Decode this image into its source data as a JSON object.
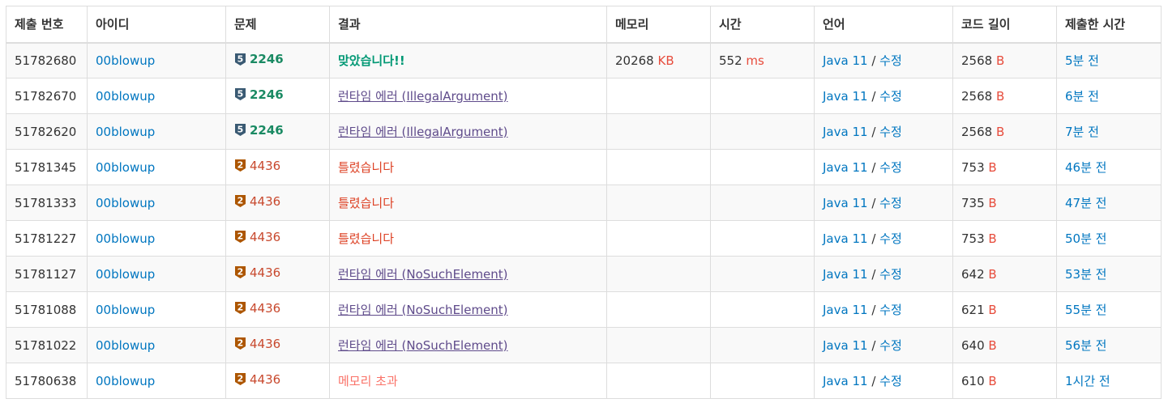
{
  "headers": {
    "submission_id": "제출 번호",
    "user_id": "아이디",
    "problem": "문제",
    "result": "결과",
    "memory": "메모리",
    "time": "시간",
    "language": "언어",
    "code_length": "코드 길이",
    "submitted_at": "제출한 시간"
  },
  "colors": {
    "link": "#0076c0",
    "accepted": "#009874",
    "wrong": "#dd4124",
    "runtime_error": "#5f4b8b",
    "memory_exceeded": "#fa7268",
    "unit": "#e74c3c",
    "platinum_badge": "#27a0a4",
    "bronze_badge": "#ad5600"
  },
  "rows": [
    {
      "id": "51782680",
      "user": "00blowup",
      "tier_icon": "platinum-5-icon",
      "tier_num": "5",
      "problem": "2246",
      "result": "맞았습니다!!",
      "result_type": "ac",
      "memory": "20268",
      "memory_unit": "KB",
      "time": "552",
      "time_unit": "ms",
      "language": "Java 11",
      "slash": "/",
      "edit": "수정",
      "length": "2568",
      "length_unit": "B",
      "submitted": "5분 전"
    },
    {
      "id": "51782670",
      "user": "00blowup",
      "tier_icon": "platinum-5-icon",
      "tier_num": "5",
      "problem": "2246",
      "result": "런타임 에러 (IllegalArgument)",
      "result_type": "rte",
      "memory": "",
      "memory_unit": "",
      "time": "",
      "time_unit": "",
      "language": "Java 11",
      "slash": "/",
      "edit": "수정",
      "length": "2568",
      "length_unit": "B",
      "submitted": "6분 전"
    },
    {
      "id": "51782620",
      "user": "00blowup",
      "tier_icon": "platinum-5-icon",
      "tier_num": "5",
      "problem": "2246",
      "result": "런타임 에러 (IllegalArgument)",
      "result_type": "rte",
      "memory": "",
      "memory_unit": "",
      "time": "",
      "time_unit": "",
      "language": "Java 11",
      "slash": "/",
      "edit": "수정",
      "length": "2568",
      "length_unit": "B",
      "submitted": "7분 전"
    },
    {
      "id": "51781345",
      "user": "00blowup",
      "tier_icon": "bronze-2-icon",
      "tier_num": "2",
      "problem": "4436",
      "result": "틀렸습니다",
      "result_type": "wa",
      "memory": "",
      "memory_unit": "",
      "time": "",
      "time_unit": "",
      "language": "Java 11",
      "slash": "/",
      "edit": "수정",
      "length": "753",
      "length_unit": "B",
      "submitted": "46분 전"
    },
    {
      "id": "51781333",
      "user": "00blowup",
      "tier_icon": "bronze-2-icon",
      "tier_num": "2",
      "problem": "4436",
      "result": "틀렸습니다",
      "result_type": "wa",
      "memory": "",
      "memory_unit": "",
      "time": "",
      "time_unit": "",
      "language": "Java 11",
      "slash": "/",
      "edit": "수정",
      "length": "735",
      "length_unit": "B",
      "submitted": "47분 전"
    },
    {
      "id": "51781227",
      "user": "00blowup",
      "tier_icon": "bronze-2-icon",
      "tier_num": "2",
      "problem": "4436",
      "result": "틀렸습니다",
      "result_type": "wa",
      "memory": "",
      "memory_unit": "",
      "time": "",
      "time_unit": "",
      "language": "Java 11",
      "slash": "/",
      "edit": "수정",
      "length": "753",
      "length_unit": "B",
      "submitted": "50분 전"
    },
    {
      "id": "51781127",
      "user": "00blowup",
      "tier_icon": "bronze-2-icon",
      "tier_num": "2",
      "problem": "4436",
      "result": "런타임 에러 (NoSuchElement)",
      "result_type": "rte",
      "memory": "",
      "memory_unit": "",
      "time": "",
      "time_unit": "",
      "language": "Java 11",
      "slash": "/",
      "edit": "수정",
      "length": "642",
      "length_unit": "B",
      "submitted": "53분 전"
    },
    {
      "id": "51781088",
      "user": "00blowup",
      "tier_icon": "bronze-2-icon",
      "tier_num": "2",
      "problem": "4436",
      "result": "런타임 에러 (NoSuchElement)",
      "result_type": "rte",
      "memory": "",
      "memory_unit": "",
      "time": "",
      "time_unit": "",
      "language": "Java 11",
      "slash": "/",
      "edit": "수정",
      "length": "621",
      "length_unit": "B",
      "submitted": "55분 전"
    },
    {
      "id": "51781022",
      "user": "00blowup",
      "tier_icon": "bronze-2-icon",
      "tier_num": "2",
      "problem": "4436",
      "result": "런타임 에러 (NoSuchElement)",
      "result_type": "rte",
      "memory": "",
      "memory_unit": "",
      "time": "",
      "time_unit": "",
      "language": "Java 11",
      "slash": "/",
      "edit": "수정",
      "length": "640",
      "length_unit": "B",
      "submitted": "56분 전"
    },
    {
      "id": "51780638",
      "user": "00blowup",
      "tier_icon": "bronze-2-icon",
      "tier_num": "2",
      "problem": "4436",
      "result": "메모리 초과",
      "result_type": "mle",
      "memory": "",
      "memory_unit": "",
      "time": "",
      "time_unit": "",
      "language": "Java 11",
      "slash": "/",
      "edit": "수정",
      "length": "610",
      "length_unit": "B",
      "submitted": "1시간 전"
    }
  ]
}
